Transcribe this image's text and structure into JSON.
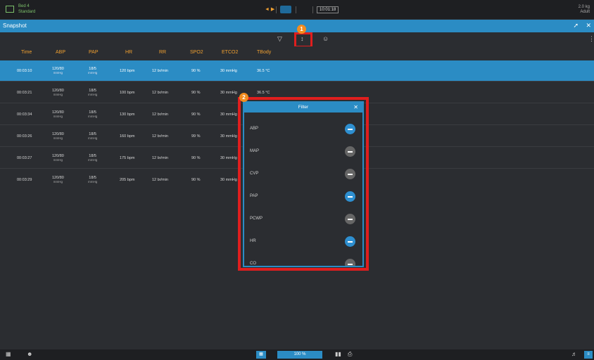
{
  "topbar": {
    "app_line1": "Bed 4",
    "app_line2": "Standard",
    "center_text": "◄ ▶",
    "clock": "10:01:18",
    "right_line1": "2.0 kg",
    "right_line2": "Adult"
  },
  "snapshot": {
    "title": "Snapshot"
  },
  "toolbar": {
    "filter_icon": "▽",
    "sort_icon": "↕",
    "person_icon": "☺"
  },
  "columns": [
    "Time",
    "ABP",
    "PAP",
    "HR",
    "RR",
    "SPO2",
    "ETCO2",
    "TBody"
  ],
  "rows": [
    {
      "time": "00:03:10",
      "abp": "120/80",
      "abp_sub": "mmHg",
      "pap": "18/5",
      "pap_sub": "mmHg",
      "hr": "120 bpm",
      "rr": "12 br/min",
      "spo2": "90 %",
      "etco2": "30 mmHg",
      "tbody": "36.5 °C",
      "selected": true
    },
    {
      "time": "00:03:21",
      "abp": "120/80",
      "abp_sub": "mmHg",
      "pap": "18/5",
      "pap_sub": "mmHg",
      "hr": "100 bpm",
      "rr": "12 br/min",
      "spo2": "90 %",
      "etco2": "30 mmHg",
      "tbody": "36.5 °C",
      "selected": false
    },
    {
      "time": "00:03:34",
      "abp": "120/80",
      "abp_sub": "mmHg",
      "pap": "18/5",
      "pap_sub": "mmHg",
      "hr": "130 bpm",
      "rr": "12 br/min",
      "spo2": "90 %",
      "etco2": "30 mmHg",
      "tbody": "",
      "selected": false
    },
    {
      "time": "00:03:26",
      "abp": "120/80",
      "abp_sub": "mmHg",
      "pap": "18/5",
      "pap_sub": "mmHg",
      "hr": "160 bpm",
      "rr": "12 br/min",
      "spo2": "99 %",
      "etco2": "30 mmHg",
      "tbody": "",
      "selected": false
    },
    {
      "time": "00:03:27",
      "abp": "120/80",
      "abp_sub": "mmHg",
      "pap": "18/5",
      "pap_sub": "mmHg",
      "hr": "175 bpm",
      "rr": "12 br/min",
      "spo2": "90 %",
      "etco2": "30 mmHg",
      "tbody": "",
      "selected": false
    },
    {
      "time": "00:03:29",
      "abp": "120/80",
      "abp_sub": "mmHg",
      "pap": "18/5",
      "pap_sub": "mmHg",
      "hr": "205 bpm",
      "rr": "12 br/min",
      "spo2": "90 %",
      "etco2": "30 mmHg",
      "tbody": "",
      "selected": false
    }
  ],
  "filter": {
    "title": "Filter",
    "close": "✕",
    "items": [
      {
        "label": "ABP",
        "on": true
      },
      {
        "label": "MAP",
        "on": false
      },
      {
        "label": "CVP",
        "on": false
      },
      {
        "label": "PAP",
        "on": true
      },
      {
        "label": "PCWP",
        "on": false
      },
      {
        "label": "HR",
        "on": true
      },
      {
        "label": "CO",
        "on": false
      }
    ]
  },
  "callouts": {
    "one": "1",
    "two": "2"
  },
  "bottombar": {
    "zoom": "100 %"
  },
  "colors": {
    "accent": "#2b8cc4",
    "highlight": "#e01e1e",
    "badge": "#f28c1e",
    "header_text": "#f0a030"
  }
}
